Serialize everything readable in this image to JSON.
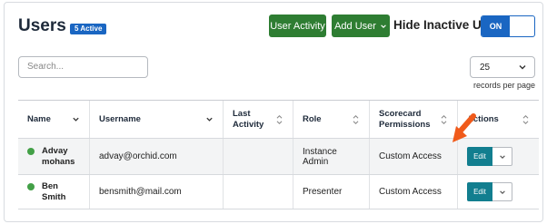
{
  "header": {
    "title": "Users",
    "active_badge": "5 Active",
    "user_activity_label": "User Activity",
    "add_user_label": "Add User",
    "hide_inactive_label": "Hide Inactive Users",
    "toggle_state": "ON"
  },
  "search": {
    "placeholder": "Search..."
  },
  "pagination": {
    "records_per_page": "25",
    "records_label": "records per page"
  },
  "table": {
    "columns": [
      "Name",
      "Username",
      "Last Activity",
      "Role",
      "Scorecard Permissions",
      "Actions"
    ],
    "rows": [
      {
        "name": "Advay mohans",
        "username": "advay@orchid.com",
        "last_activity": "",
        "role": "Instance Admin",
        "scorecard": "Custom Access",
        "action": "Edit"
      },
      {
        "name": "Ben Smith",
        "username": "bensmith@mail.com",
        "last_activity": "",
        "role": "Presenter",
        "scorecard": "Custom Access",
        "action": "Edit"
      }
    ]
  },
  "colors": {
    "green_button": "#2e7d32",
    "accent_blue": "#1a66c2",
    "edit_teal": "#127e8f",
    "status_active": "#43a047",
    "annotation_arrow": "#f05a1a"
  },
  "icons": {
    "add_user_dropdown": "chevron-down-icon",
    "per_page_dropdown": "chevron-down-icon",
    "sort_name": "chevron-down-icon",
    "sort_username": "chevron-down-icon",
    "sort_other": "sort-icon",
    "row_actions": "chevron-down-icon",
    "annotation": "arrow-pointer-icon"
  }
}
